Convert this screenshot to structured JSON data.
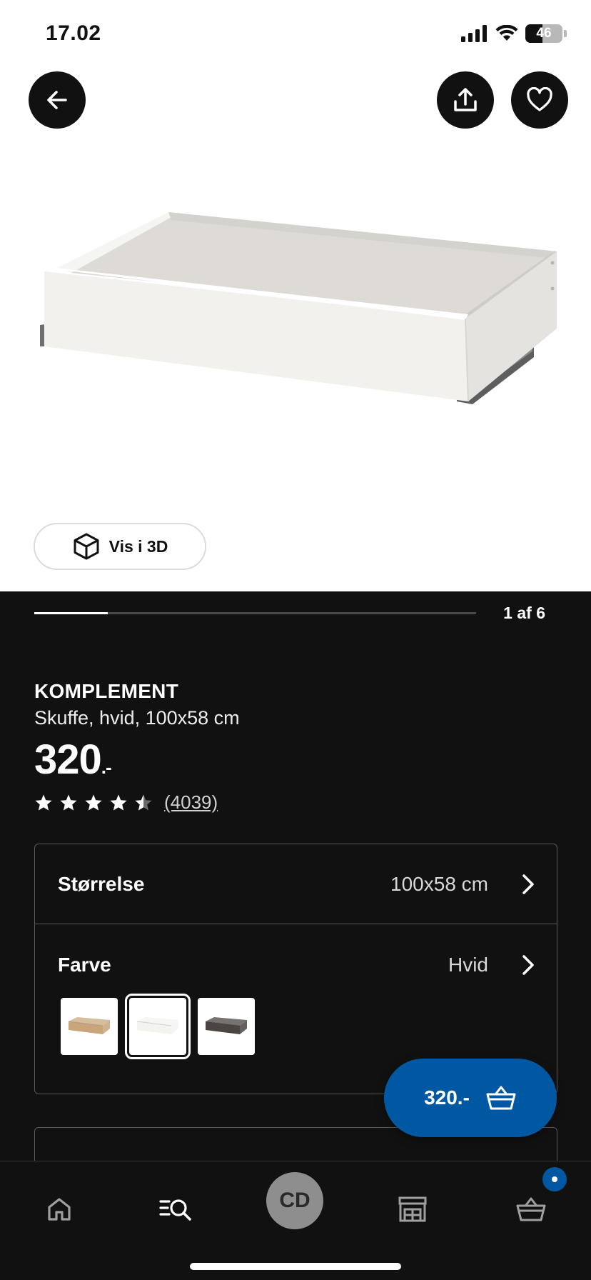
{
  "status_bar": {
    "time": "17.02",
    "battery_level": "46",
    "battery_percent": 46
  },
  "header": {
    "back_icon": "arrow-left-icon",
    "share_icon": "share-icon",
    "favorite_icon": "heart-icon"
  },
  "gallery": {
    "view_3d_label": "Vis i 3D",
    "current_index": 1,
    "total": 6,
    "counter_label": "1 af 6"
  },
  "product": {
    "name": "KOMPLEMENT",
    "description": "Skuffe, hvid, 100x58 cm",
    "price": "320",
    "price_suffix": ".-",
    "rating": 4.5,
    "review_count": "(4039)"
  },
  "options": {
    "size": {
      "label": "Størrelse",
      "value": "100x58 cm"
    },
    "color": {
      "label": "Farve",
      "value": "Hvid",
      "swatches": [
        {
          "name": "oak",
          "color": "#c9a57c",
          "selected": false
        },
        {
          "name": "white",
          "color": "#f3f3f0",
          "selected": true
        },
        {
          "name": "dark-brown",
          "color": "#4a4442",
          "selected": false
        }
      ]
    }
  },
  "cart_button": {
    "label": "320.-",
    "icon": "basket-icon"
  },
  "bottom_nav": {
    "items": [
      {
        "name": "home",
        "icon": "home-icon"
      },
      {
        "name": "search",
        "icon": "search-icon"
      },
      {
        "name": "profile",
        "initials": "CD"
      },
      {
        "name": "stores",
        "icon": "store-icon"
      },
      {
        "name": "cart",
        "icon": "basket-icon"
      }
    ]
  },
  "colors": {
    "accent": "#0058a3",
    "background": "#111111"
  }
}
